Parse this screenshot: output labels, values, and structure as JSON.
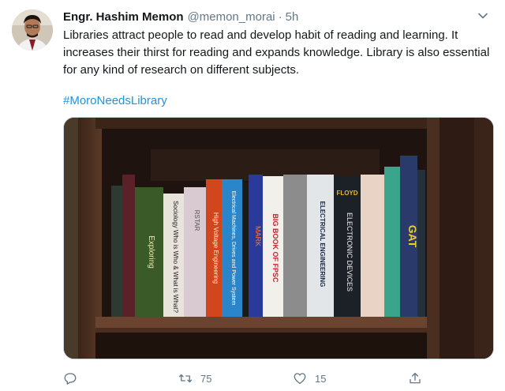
{
  "tweet": {
    "author_name": "Engr. Hashim Memon",
    "handle": "@memon_morai",
    "separator": "·",
    "time": "5h",
    "text": "Libraries attract people to read and develop habit of reading and learning. It increases their thirst for reading and expands knowledge. Library is also essential for any kind of research on different subjects.",
    "hashtag": "#MoroNeedsLibrary"
  },
  "book_spines": [
    "Exploring",
    "Sociology Who is Who & What is What?",
    "RSTAR",
    "High Voltage Engineering",
    "Electrical Machines, Drives and Power System",
    "MARK",
    "BIG BOOK OF FPSC",
    "ELECTRICAL ENGINEERING",
    "ELECTRONIC DEVICES",
    "FLOYD",
    "GAT"
  ],
  "actions": {
    "reply_icon": "reply-icon",
    "retweet_icon": "retweet-icon",
    "retweet_count": "75",
    "like_icon": "heart-icon",
    "like_count": "15",
    "share_icon": "share-icon"
  },
  "colors": {
    "text_primary": "#14171a",
    "text_secondary": "#657786",
    "link": "#1b95e0"
  }
}
